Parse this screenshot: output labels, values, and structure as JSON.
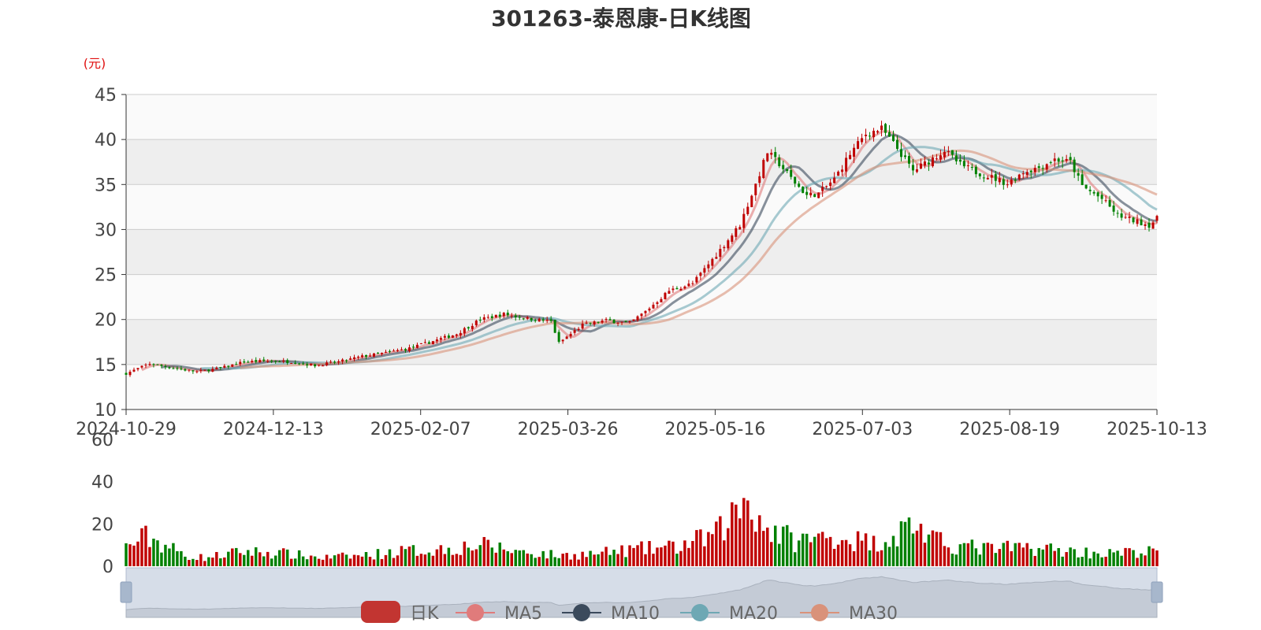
{
  "chart_data": {
    "type": "candlestick",
    "title": "301263-泰恩康-日K线图",
    "unit_label": "(元)",
    "price_axis": {
      "ylim": [
        10,
        45
      ],
      "ticks": [
        "10",
        "15",
        "20",
        "25",
        "30",
        "35",
        "40",
        "45"
      ]
    },
    "volume_axis": {
      "ylim": [
        0,
        60
      ],
      "ticks": [
        "0",
        "20",
        "40",
        "60"
      ]
    },
    "x_tick_labels": [
      "2024-10-29",
      "2024-12-13",
      "2025-02-07",
      "2025-03-26",
      "2025-05-16",
      "2025-07-03",
      "2025-08-19",
      "2025-10-13"
    ],
    "price_path": [
      [
        0,
        14.0
      ],
      [
        6,
        15.1
      ],
      [
        12,
        14.6
      ],
      [
        18,
        14.2
      ],
      [
        24,
        14.6
      ],
      [
        30,
        15.3
      ],
      [
        36,
        15.4
      ],
      [
        42,
        15.3
      ],
      [
        48,
        14.9
      ],
      [
        54,
        15.3
      ],
      [
        60,
        15.9
      ],
      [
        66,
        16.3
      ],
      [
        72,
        16.8
      ],
      [
        78,
        17.6
      ],
      [
        84,
        18.4
      ],
      [
        90,
        20.0
      ],
      [
        96,
        20.6
      ],
      [
        102,
        20.1
      ],
      [
        108,
        19.8
      ],
      [
        110,
        17.4
      ],
      [
        116,
        19.4
      ],
      [
        122,
        19.9
      ],
      [
        128,
        19.6
      ],
      [
        132,
        20.9
      ],
      [
        138,
        23.2
      ],
      [
        144,
        24.0
      ],
      [
        150,
        27.2
      ],
      [
        156,
        30.5
      ],
      [
        160,
        35.0
      ],
      [
        163,
        38.6
      ],
      [
        166,
        37.3
      ],
      [
        170,
        35.2
      ],
      [
        173,
        33.8
      ],
      [
        176,
        34.0
      ],
      [
        180,
        35.6
      ],
      [
        184,
        38.4
      ],
      [
        188,
        40.6
      ],
      [
        192,
        41.2
      ],
      [
        196,
        39.0
      ],
      [
        200,
        36.5
      ],
      [
        204,
        37.6
      ],
      [
        208,
        38.8
      ],
      [
        212,
        37.2
      ],
      [
        216,
        36.4
      ],
      [
        220,
        35.8
      ],
      [
        224,
        35.1
      ],
      [
        228,
        36.4
      ],
      [
        232,
        36.9
      ],
      [
        236,
        37.8
      ],
      [
        240,
        37.5
      ],
      [
        243,
        34.8
      ],
      [
        248,
        33.4
      ],
      [
        252,
        31.6
      ],
      [
        256,
        31.0
      ],
      [
        260,
        30.5
      ],
      [
        262,
        31.2
      ]
    ],
    "volume_profile": [
      [
        0,
        9
      ],
      [
        5,
        14
      ],
      [
        10,
        10
      ],
      [
        15,
        5
      ],
      [
        20,
        4
      ],
      [
        30,
        7
      ],
      [
        40,
        6
      ],
      [
        50,
        4
      ],
      [
        60,
        5
      ],
      [
        70,
        7
      ],
      [
        80,
        8
      ],
      [
        90,
        10
      ],
      [
        100,
        7
      ],
      [
        110,
        5
      ],
      [
        120,
        6
      ],
      [
        130,
        8
      ],
      [
        140,
        9
      ],
      [
        150,
        15
      ],
      [
        155,
        26
      ],
      [
        158,
        33
      ],
      [
        162,
        19
      ],
      [
        170,
        12
      ],
      [
        180,
        14
      ],
      [
        190,
        11
      ],
      [
        196,
        15
      ],
      [
        200,
        21
      ],
      [
        205,
        12
      ],
      [
        210,
        10
      ],
      [
        220,
        8
      ],
      [
        230,
        9
      ],
      [
        240,
        7
      ],
      [
        250,
        6
      ],
      [
        262,
        7
      ]
    ],
    "series": [
      {
        "name": "日K",
        "color": "#c23531"
      },
      {
        "name": "MA5",
        "color": "#e07b7b",
        "window": 5
      },
      {
        "name": "MA10",
        "color": "#3b4a5c",
        "window": 10
      },
      {
        "name": "MA20",
        "color": "#6ea8b4",
        "window": 20
      },
      {
        "name": "MA30",
        "color": "#d9927a",
        "window": 30
      }
    ],
    "colors": {
      "up": "#c00000",
      "down": "#008000",
      "grid": "#cccccc",
      "band": "#eeeeee",
      "zoom_fill": "#d6dde8"
    }
  }
}
